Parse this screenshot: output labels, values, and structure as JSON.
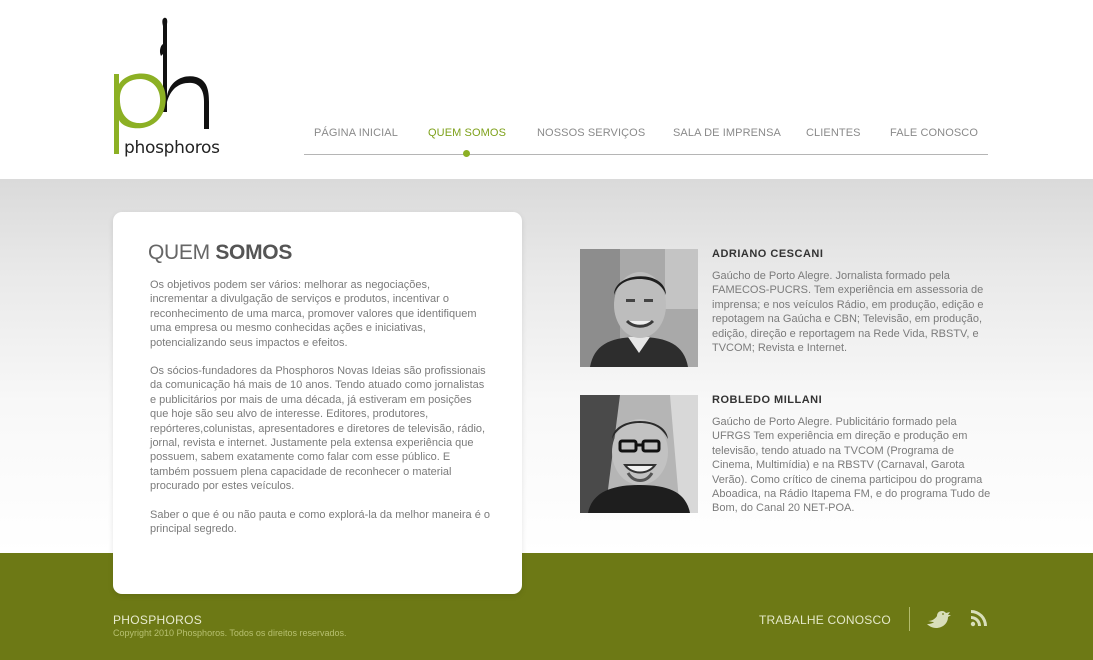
{
  "brand": {
    "logo_text": "phosphoros",
    "accent": "#8cb024",
    "footer_color": "#6d7915"
  },
  "nav": {
    "items": [
      {
        "label": "PÁGINA INICIAL",
        "active": false
      },
      {
        "label": "QUEM SOMOS",
        "active": true
      },
      {
        "label": "NOSSOS SERVIÇOS",
        "active": false
      },
      {
        "label": "SALA DE IMPRENSA",
        "active": false
      },
      {
        "label": "CLIENTES",
        "active": false
      },
      {
        "label": "FALE CONOSCO",
        "active": false
      }
    ]
  },
  "about": {
    "title_light": "QUEM ",
    "title_bold": "SOMOS",
    "paragraphs": [
      "Os objetivos podem ser vários: melhorar as negociações, incrementar a divulgação de serviços e produtos, incentivar o reconhecimento de uma marca, promover valores que identifiquem uma empresa ou mesmo conhecidas ações e iniciativas, potencializando seus impactos e efeitos.",
      "Os sócios-fundadores da Phosphoros Novas Ideias são profissionais da comunicação há mais de 10 anos. Tendo atuado como jornalistas e publicitários por mais de uma década, já estiveram em posições que hoje são seu alvo de interesse. Editores, produtores, repórteres,colunistas, apresentadores e diretores de televisão, rádio, jornal, revista e internet. Justamente pela extensa experiência que possuem, sabem exatamente como falar com esse público. E também possuem plena capacidade de reconhecer o material procurado por estes veículos.",
      "Saber o que é ou não pauta e como explorá-la da melhor maneira é o principal segredo."
    ]
  },
  "people": [
    {
      "name": "ADRIANO CESCANI",
      "bio": "Gaúcho de Porto Alegre. Jornalista formado pela FAMECOS-PUCRS. Tem experiência em assessoria de imprensa; e nos veículos Rádio, em produção, edição e repotagem na Gaúcha e CBN; Televisão, em produção, edição, direção e reportagem na Rede Vida, RBSTV, e TVCOM; Revista e Internet."
    },
    {
      "name": "ROBLEDO MILLANI",
      "bio": "Gaúcho de Porto Alegre. Publicitário formado pela UFRGS Tem experiência em direção e produção em televisão, tendo atuado na TVCOM (Programa de Cinema, Multimídia) e na RBSTV (Carnaval, Garota Verão). Como crítico de cinema participou do programa Aboadica, na Rádio Itapema FM, e do programa Tudo de Bom, do Canal 20 NET-POA."
    }
  ],
  "footer": {
    "brand": "PHOSPHOROS",
    "copyright": "Copyright 2010 Phosphoros. Todos os direitos reservados.",
    "work_link": "TRABALHE CONOSCO",
    "icons": [
      "twitter-bird-icon",
      "rss-icon"
    ]
  }
}
